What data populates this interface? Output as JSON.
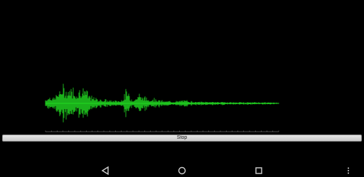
{
  "controls": {
    "stop_label": "Stop"
  },
  "axis": {
    "tick_labels": [
      "",
      "",
      "",
      "",
      ""
    ]
  },
  "colors": {
    "background": "#000000",
    "waveform": "#22dd22",
    "axis": "#9a9a9a"
  },
  "nav": {
    "icons": [
      "back-icon",
      "home-icon",
      "recents-icon",
      "menu-icon"
    ]
  }
}
